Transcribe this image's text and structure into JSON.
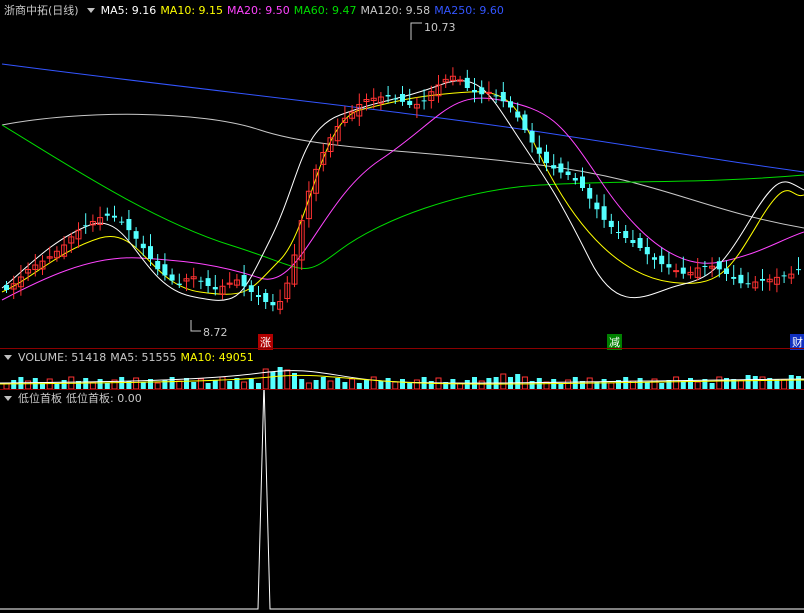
{
  "main_panel": {
    "stock_name": "浙商中拓(日线)",
    "indicators": [
      {
        "label": "MA5: 9.16",
        "color": "#ffffff"
      },
      {
        "label": "MA10: 9.15",
        "color": "#ffff00"
      },
      {
        "label": "MA20: 9.50",
        "color": "#ff44ff"
      },
      {
        "label": "MA60: 9.47",
        "color": "#00dd00"
      },
      {
        "label": "MA120: 9.58",
        "color": "#c8c8c8"
      },
      {
        "label": "MA250: 9.60",
        "color": "#3355ff"
      }
    ],
    "high_label": "10.73",
    "low_label": "8.72",
    "markers": [
      {
        "text": "涨",
        "bg": "#b00000",
        "fg": "#ffffff"
      },
      {
        "text": "减",
        "bg": "#008000",
        "fg": "#ffffff"
      },
      {
        "text": "财",
        "bg": "#1030c0",
        "fg": "#ffffff"
      }
    ]
  },
  "volume_panel": {
    "title": "VOLUME: 51418",
    "ma5": "MA5: 51555",
    "ma10": "MA10: 49051"
  },
  "indicator_panel": {
    "name": "低位首板",
    "value": "低位首板: 0.00"
  },
  "colors": {
    "up": "#ff3232",
    "down": "#54ffff",
    "separator": "#8b0000",
    "background": "#000000"
  },
  "chart_data": {
    "type": "candlestick",
    "price_range": [
      8.72,
      10.73
    ],
    "annotated_high": 10.73,
    "annotated_low": 8.72,
    "volume": 51418,
    "volume_ma5": 51555,
    "volume_ma10": 49051
  }
}
